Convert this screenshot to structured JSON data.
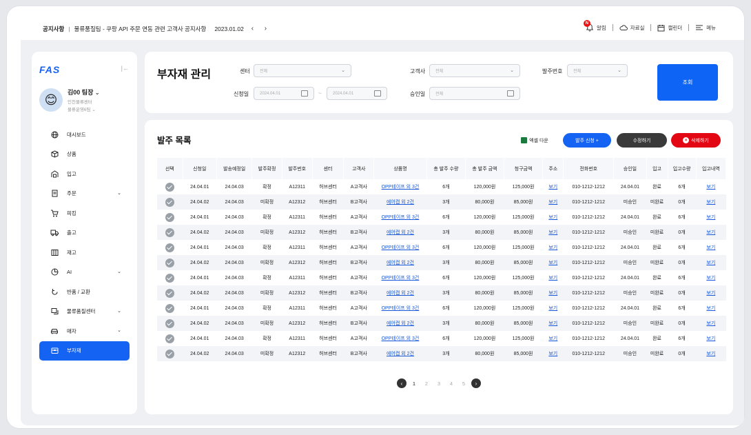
{
  "topbar": {
    "notice_label": "공지사항",
    "notice_text": "물류품질팀 - 쿠팡 API 주문 연동 관련 고객사 공지사항",
    "notice_date": "2023.01.02",
    "nav": [
      {
        "label": "알림",
        "badge": "N"
      },
      {
        "label": "자료실"
      },
      {
        "label": "캘린더"
      },
      {
        "label": "메뉴"
      }
    ]
  },
  "sidebar": {
    "logo": "FAS",
    "user_name": "김00 팀장",
    "user_center": "인천물류센터",
    "user_dept": "물류운영6팀",
    "items": [
      {
        "label": "대시보드",
        "icon": "globe-icon"
      },
      {
        "label": "상품",
        "icon": "box-icon"
      },
      {
        "label": "입고",
        "icon": "warehouse-icon"
      },
      {
        "label": "주문",
        "icon": "order-icon",
        "expand": true
      },
      {
        "label": "피킹",
        "icon": "cart-icon"
      },
      {
        "label": "출고",
        "icon": "truck-icon"
      },
      {
        "label": "재고",
        "icon": "inventory-icon"
      },
      {
        "label": "AI",
        "icon": "chart-pie-icon",
        "expand": true
      },
      {
        "label": "반품 / 교환",
        "icon": "return-icon"
      },
      {
        "label": "물류품질센터",
        "icon": "quality-icon",
        "expand": true
      },
      {
        "label": "매자",
        "icon": "car-icon",
        "expand": true
      },
      {
        "label": "부자재",
        "icon": "materials-icon",
        "active": true
      }
    ]
  },
  "filter": {
    "title": "부자재 관리",
    "center_label": "센터",
    "center_value": "전체",
    "client_label": "고객사",
    "client_value": "전체",
    "order_no_label": "발주번호",
    "order_no_value": "전체",
    "date_label": "신청일",
    "date_from": "2024.04.01",
    "date_to": "2024.04.01",
    "date_sep": "~",
    "approve_label": "승인일",
    "approve_value": "전체",
    "search_button": "조회"
  },
  "list": {
    "title": "발주 목록",
    "excel_label": "엑셀 다운",
    "request_label": "발주 신청 +",
    "edit_label": "수정하기",
    "delete_label": "삭제하기",
    "columns": [
      "선택",
      "신청일",
      "발송예정일",
      "발주확정",
      "발주번호",
      "센터",
      "고객사",
      "상품명",
      "총 발주 수량",
      "총 발주 금액",
      "청구금액",
      "주소",
      "전화번호",
      "승인일",
      "입고",
      "입고수량",
      "입고내역"
    ],
    "rows": [
      [
        "24.04.01",
        "24.04.03",
        "확정",
        "A12311",
        "허브센터",
        "A고객사",
        "OPP테이프 외 3건",
        "6개",
        "120,000원",
        "125,000원",
        "보기",
        "010-1212-1212",
        "24.04.01",
        "완료",
        "6개",
        "보기"
      ],
      [
        "24.04.02",
        "24.04.03",
        "미확정",
        "A12312",
        "허브센터",
        "B고객사",
        "에어캡 외 2건",
        "3개",
        "80,000원",
        "85,000원",
        "보기",
        "010-1212-1212",
        "미승인",
        "미완료",
        "0개",
        "보기"
      ],
      [
        "24.04.01",
        "24.04.03",
        "확정",
        "A12311",
        "허브센터",
        "A고객사",
        "OPP테이프 외 3건",
        "6개",
        "120,000원",
        "125,000원",
        "보기",
        "010-1212-1212",
        "24.04.01",
        "완료",
        "6개",
        "보기"
      ],
      [
        "24.04.02",
        "24.04.03",
        "미확정",
        "A12312",
        "허브센터",
        "B고객사",
        "에어캡 외 2건",
        "3개",
        "80,000원",
        "85,000원",
        "보기",
        "010-1212-1212",
        "미승인",
        "미완료",
        "0개",
        "보기"
      ],
      [
        "24.04.01",
        "24.04.03",
        "확정",
        "A12311",
        "허브센터",
        "A고객사",
        "OPP테이프 외 3건",
        "6개",
        "120,000원",
        "125,000원",
        "보기",
        "010-1212-1212",
        "24.04.01",
        "완료",
        "6개",
        "보기"
      ],
      [
        "24.04.02",
        "24.04.03",
        "미확정",
        "A12312",
        "허브센터",
        "B고객사",
        "에어캡 외 2건",
        "3개",
        "80,000원",
        "85,000원",
        "보기",
        "010-1212-1212",
        "미승인",
        "미완료",
        "0개",
        "보기"
      ],
      [
        "24.04.01",
        "24.04.03",
        "확정",
        "A12311",
        "허브센터",
        "A고객사",
        "OPP테이프 외 3건",
        "6개",
        "120,000원",
        "125,000원",
        "보기",
        "010-1212-1212",
        "24.04.01",
        "완료",
        "6개",
        "보기"
      ],
      [
        "24.04.02",
        "24.04.03",
        "미확정",
        "A12312",
        "허브센터",
        "B고객사",
        "에어캡 외 2건",
        "3개",
        "80,000원",
        "85,000원",
        "보기",
        "010-1212-1212",
        "미승인",
        "미완료",
        "0개",
        "보기"
      ],
      [
        "24.04.01",
        "24.04.03",
        "확정",
        "A12311",
        "허브센터",
        "A고객사",
        "OPP테이프 외 3건",
        "6개",
        "120,000원",
        "125,000원",
        "보기",
        "010-1212-1212",
        "24.04.01",
        "완료",
        "6개",
        "보기"
      ],
      [
        "24.04.02",
        "24.04.03",
        "미확정",
        "A12312",
        "허브센터",
        "B고객사",
        "에어캡 외 2건",
        "3개",
        "80,000원",
        "85,000원",
        "보기",
        "010-1212-1212",
        "미승인",
        "미완료",
        "0개",
        "보기"
      ],
      [
        "24.04.01",
        "24.04.03",
        "확정",
        "A12311",
        "허브센터",
        "A고객사",
        "OPP테이프 외 3건",
        "6개",
        "120,000원",
        "125,000원",
        "보기",
        "010-1212-1212",
        "24.04.01",
        "완료",
        "6개",
        "보기"
      ],
      [
        "24.04.02",
        "24.04.03",
        "미확정",
        "A12312",
        "허브센터",
        "B고객사",
        "에어캡 외 2건",
        "3개",
        "80,000원",
        "85,000원",
        "보기",
        "010-1212-1212",
        "미승인",
        "미완료",
        "0개",
        "보기"
      ]
    ],
    "pages": [
      "1",
      "2",
      "3",
      "4",
      "5"
    ],
    "current_page": "1"
  },
  "colors": {
    "primary": "#1463f2",
    "delete": "#e30613",
    "edit": "#3a3a3a",
    "excel": "#1d7a3e"
  }
}
